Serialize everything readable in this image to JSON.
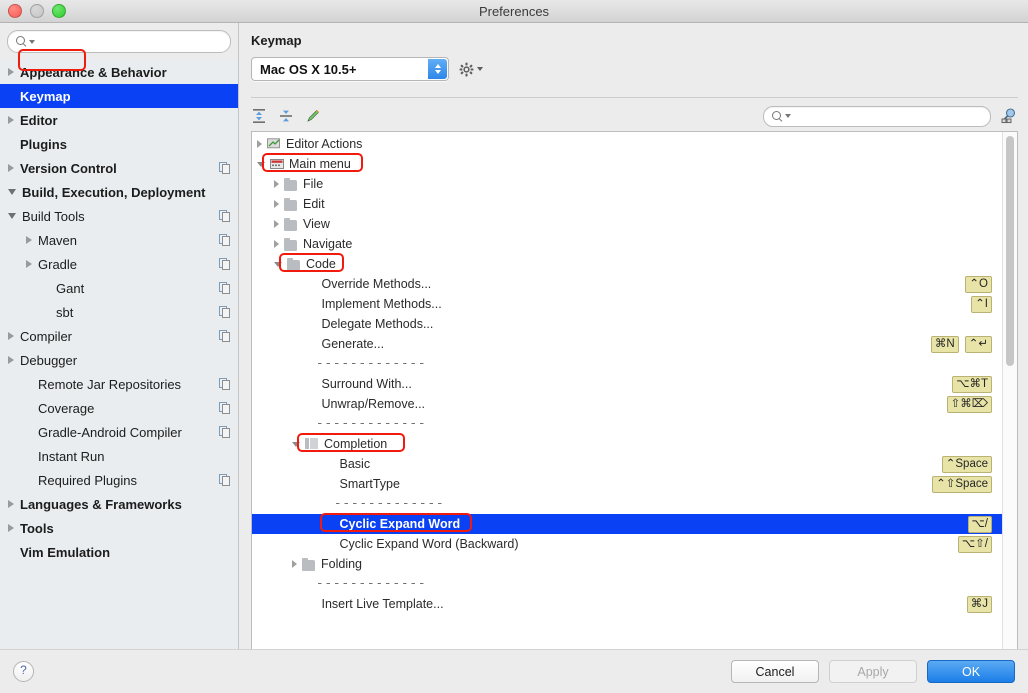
{
  "window": {
    "title": "Preferences",
    "traffic_lights": [
      "close-red",
      "minimize-gray",
      "zoom-green"
    ]
  },
  "sidebar": {
    "search": {
      "value": "",
      "placeholder": ""
    },
    "items": [
      {
        "label": "Appearance & Behavior",
        "arrow": "closed",
        "bold": true,
        "indent": 0,
        "badge": false
      },
      {
        "label": "Keymap",
        "arrow": "none",
        "bold": true,
        "indent": 1,
        "badge": false,
        "selected": true,
        "highlighted": true
      },
      {
        "label": "Editor",
        "arrow": "closed",
        "bold": true,
        "indent": 0,
        "badge": false
      },
      {
        "label": "Plugins",
        "arrow": "none",
        "bold": true,
        "indent": 1,
        "badge": false
      },
      {
        "label": "Version Control",
        "arrow": "closed",
        "bold": true,
        "indent": 0,
        "badge": true
      },
      {
        "label": "Build, Execution, Deployment",
        "arrow": "open",
        "bold": true,
        "indent": 0,
        "badge": false
      },
      {
        "label": "Build Tools",
        "arrow": "open",
        "bold": false,
        "indent": 1,
        "badge": true
      },
      {
        "label": "Maven",
        "arrow": "closed",
        "bold": false,
        "indent": 2,
        "badge": true
      },
      {
        "label": "Gradle",
        "arrow": "closed",
        "bold": false,
        "indent": 2,
        "badge": true
      },
      {
        "label": "Gant",
        "arrow": "none",
        "bold": false,
        "indent": 3,
        "badge": true
      },
      {
        "label": "sbt",
        "arrow": "none",
        "bold": false,
        "indent": 3,
        "badge": true
      },
      {
        "label": "Compiler",
        "arrow": "closed",
        "bold": false,
        "indent": 1,
        "badge": true
      },
      {
        "label": "Debugger",
        "arrow": "closed",
        "bold": false,
        "indent": 1,
        "badge": false
      },
      {
        "label": "Remote Jar Repositories",
        "arrow": "none",
        "bold": false,
        "indent": 2,
        "badge": true
      },
      {
        "label": "Coverage",
        "arrow": "none",
        "bold": false,
        "indent": 2,
        "badge": true
      },
      {
        "label": "Gradle-Android Compiler",
        "arrow": "none",
        "bold": false,
        "indent": 2,
        "badge": true
      },
      {
        "label": "Instant Run",
        "arrow": "none",
        "bold": false,
        "indent": 2,
        "badge": false
      },
      {
        "label": "Required Plugins",
        "arrow": "none",
        "bold": false,
        "indent": 2,
        "badge": true
      },
      {
        "label": "Languages & Frameworks",
        "arrow": "closed",
        "bold": true,
        "indent": 0,
        "badge": false
      },
      {
        "label": "Tools",
        "arrow": "closed",
        "bold": true,
        "indent": 0,
        "badge": false
      },
      {
        "label": "Vim Emulation",
        "arrow": "none",
        "bold": true,
        "indent": 1,
        "badge": false
      }
    ]
  },
  "pane": {
    "title": "Keymap",
    "keymap_select": {
      "value": "Mac OS X 10.5+"
    },
    "gear_icon": "gear-icon",
    "toolbar": {
      "expand_all": "expand-all-icon",
      "collapse_all": "collapse-all-icon",
      "edit": "edit-pencil-icon",
      "search": {
        "value": "",
        "placeholder": ""
      },
      "find_shortcut": "find-by-shortcut-icon"
    }
  },
  "actions": [
    {
      "label": "Editor Actions",
      "arrow": "closed",
      "icon": "editor-actions-icon",
      "indent": 0,
      "keys": []
    },
    {
      "label": "Main menu",
      "arrow": "open",
      "icon": "main-menu-icon",
      "indent": 0,
      "keys": [],
      "highlighted": true
    },
    {
      "label": "File",
      "arrow": "closed",
      "icon": "folder-icon",
      "indent": 1,
      "keys": []
    },
    {
      "label": "Edit",
      "arrow": "closed",
      "icon": "folder-icon",
      "indent": 1,
      "keys": []
    },
    {
      "label": "View",
      "arrow": "closed",
      "icon": "folder-icon",
      "indent": 1,
      "keys": []
    },
    {
      "label": "Navigate",
      "arrow": "closed",
      "icon": "folder-icon",
      "indent": 1,
      "keys": []
    },
    {
      "label": "Code",
      "arrow": "open",
      "icon": "folder-icon",
      "indent": 1,
      "keys": [],
      "highlighted": true
    },
    {
      "label": "Override Methods...",
      "arrow": "none",
      "icon": "none",
      "indent": 2,
      "keys": [
        "⌃O"
      ]
    },
    {
      "label": "Implement Methods...",
      "arrow": "none",
      "icon": "none",
      "indent": 2,
      "keys": [
        "⌃I"
      ]
    },
    {
      "label": "Delegate Methods...",
      "arrow": "none",
      "icon": "none",
      "indent": 2,
      "keys": []
    },
    {
      "label": "Generate...",
      "arrow": "none",
      "icon": "none",
      "indent": 2,
      "keys": [
        "⌘N",
        "⌃↵"
      ]
    },
    {
      "separator": true,
      "label": "-------------",
      "indent": 2
    },
    {
      "label": "Surround With...",
      "arrow": "none",
      "icon": "none",
      "indent": 2,
      "keys": [
        "⌥⌘T"
      ]
    },
    {
      "label": "Unwrap/Remove...",
      "arrow": "none",
      "icon": "none",
      "indent": 2,
      "keys": [
        "⇧⌘⌦"
      ]
    },
    {
      "separator": true,
      "label": "-------------",
      "indent": 2
    },
    {
      "label": "Completion",
      "arrow": "open",
      "icon": "group-icon",
      "indent": 2,
      "keys": [],
      "highlighted": true
    },
    {
      "label": "Basic",
      "arrow": "none",
      "icon": "none",
      "indent": 3,
      "keys": [
        "⌃Space"
      ]
    },
    {
      "label": "SmartType",
      "arrow": "none",
      "icon": "none",
      "indent": 3,
      "keys": [
        "⌃⇧Space"
      ]
    },
    {
      "separator": true,
      "label": "-------------",
      "indent": 3
    },
    {
      "label": "Cyclic Expand Word",
      "arrow": "none",
      "icon": "none",
      "indent": 3,
      "keys": [
        "⌥/"
      ],
      "selected": true,
      "highlighted": true
    },
    {
      "label": "Cyclic Expand Word (Backward)",
      "arrow": "none",
      "icon": "none",
      "indent": 3,
      "keys": [
        "⌥⇧/"
      ]
    },
    {
      "label": "Folding",
      "arrow": "closed",
      "icon": "folder-icon",
      "indent": 2,
      "keys": []
    },
    {
      "separator": true,
      "label": "-------------",
      "indent": 2
    },
    {
      "label": "Insert Live Template...",
      "arrow": "none",
      "icon": "none",
      "indent": 2,
      "keys": [
        "⌘J"
      ]
    }
  ],
  "footer": {
    "help_label": "?",
    "cancel_label": "Cancel",
    "apply_label": "Apply",
    "ok_label": "OK"
  },
  "colors": {
    "selection_blue": "#0a41f5",
    "highlight_red": "#f01b0e",
    "key_chip_bg": "#e8e4a8",
    "ok_button_blue": "#1c7ee8"
  }
}
